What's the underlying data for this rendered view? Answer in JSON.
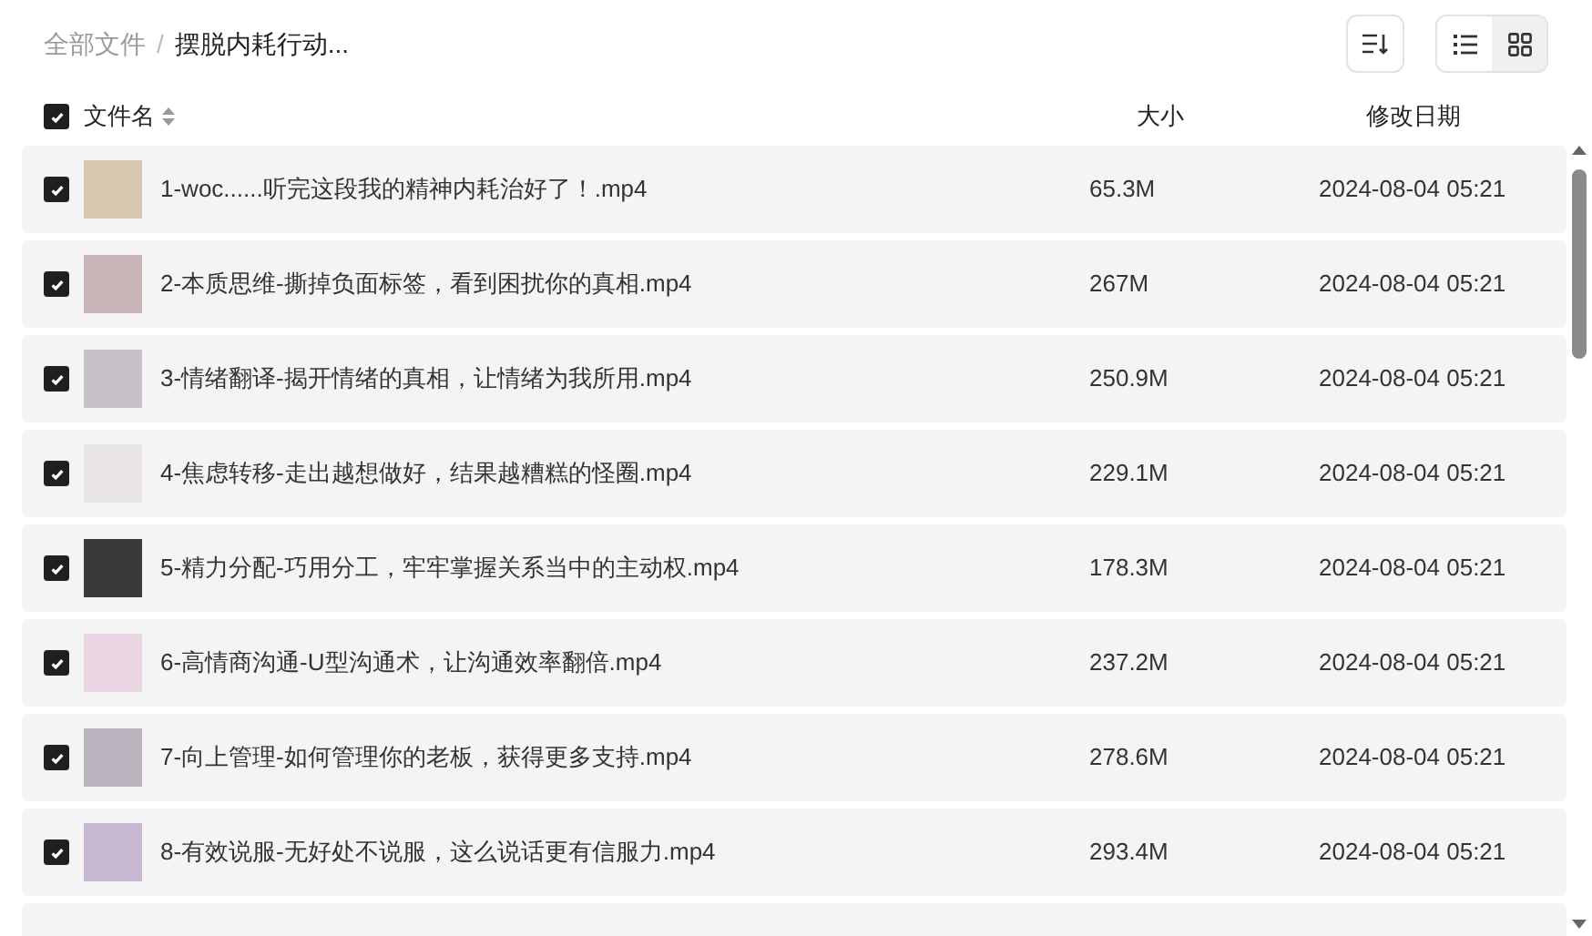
{
  "breadcrumb": [
    {
      "label": "全部文件"
    },
    {
      "label": "摆脱内耗行动..."
    }
  ],
  "breadcrumb_separator": "/",
  "view_toggle": [
    {
      "kind": "list",
      "selected": true
    },
    {
      "kind": "grid",
      "selected": false
    }
  ],
  "table": {
    "select_all_checked": true,
    "columns": [
      {
        "label": "文件名",
        "sortable": true
      },
      {
        "label": "大小"
      },
      {
        "label": "修改日期"
      }
    ],
    "rows": [
      {
        "checked": true,
        "name": "1-woc......听完这段我的精神内耗治好了！.mp4",
        "size": "65.3M",
        "modified": "2024-08-04 05:21"
      },
      {
        "checked": true,
        "name": "2-本质思维-撕掉负面标签，看到困扰你的真相.mp4",
        "size": "267M",
        "modified": "2024-08-04 05:21"
      },
      {
        "checked": true,
        "name": "3-情绪翻译-揭开情绪的真相，让情绪为我所用.mp4",
        "size": "250.9M",
        "modified": "2024-08-04 05:21"
      },
      {
        "checked": true,
        "name": "4-焦虑转移-走出越想做好，结果越糟糕的怪圈.mp4",
        "size": "229.1M",
        "modified": "2024-08-04 05:21"
      },
      {
        "checked": true,
        "name": "5-精力分配-巧用分工，牢牢掌握关系当中的主动权.mp4",
        "size": "178.3M",
        "modified": "2024-08-04 05:21"
      },
      {
        "checked": true,
        "name": "6-高情商沟通-U型沟通术，让沟通效率翻倍.mp4",
        "size": "237.2M",
        "modified": "2024-08-04 05:21"
      },
      {
        "checked": true,
        "name": "7-向上管理-如何管理你的老板，获得更多支持.mp4",
        "size": "278.6M",
        "modified": "2024-08-04 05:21"
      },
      {
        "checked": true,
        "name": "8-有效说服-无好处不说服，这么说话更有信服力.mp4",
        "size": "293.4M",
        "modified": "2024-08-04 05:21"
      }
    ]
  }
}
